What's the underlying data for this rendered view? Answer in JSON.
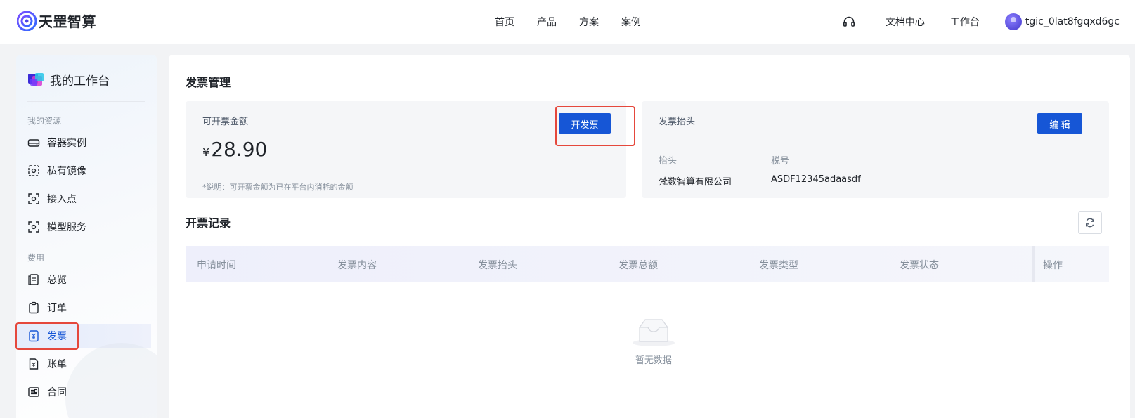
{
  "brand": {
    "name": "天罡智算"
  },
  "top_nav": {
    "center": [
      "首页",
      "产品",
      "方案",
      "案例"
    ],
    "right": [
      "文档中心",
      "工作台"
    ],
    "support_icon": "headset-icon",
    "username": "tgic_0lat8fgqxd6gc"
  },
  "sidebar": {
    "title": "我的工作台",
    "groups": [
      {
        "label": "我的资源",
        "items": [
          "容器实例",
          "私有镜像",
          "接入点",
          "模型服务"
        ]
      },
      {
        "label": "费用",
        "items": [
          "总览",
          "订单",
          "发票",
          "账单",
          "合同"
        ]
      }
    ],
    "active_item": "发票",
    "accent": "#1656d6"
  },
  "invoice": {
    "title": "发票管理",
    "amount_panel": {
      "label": "可开票金额",
      "currency": "¥",
      "amount": "28.90",
      "note": "*说明：可开票金额为已在平台内消耗的金额",
      "button": "开发票"
    },
    "header_panel": {
      "label": "发票抬头",
      "button": "编 辑",
      "fields": [
        {
          "key": "抬头",
          "value": "梵数智算有限公司"
        },
        {
          "key": "税号",
          "value": "ASDF12345adaasdf"
        }
      ]
    }
  },
  "records": {
    "title": "开票记录",
    "columns": [
      "申请时间",
      "发票内容",
      "发票抬头",
      "发票总额",
      "发票类型",
      "发票状态",
      "操作"
    ],
    "rows": [],
    "empty_text": "暂无数据"
  },
  "colors": {
    "primary": "#1656d6",
    "highlight": "#e5483c"
  }
}
